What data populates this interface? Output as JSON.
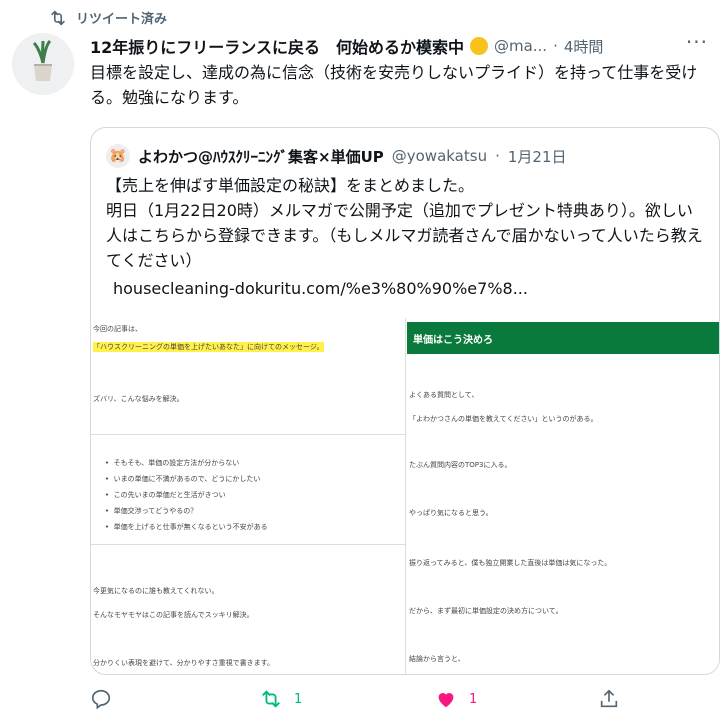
{
  "retweet": {
    "label": "リツイート済み"
  },
  "tweet": {
    "name": "12年振りにフリーランスに戻る　何始めるか模索中",
    "handle": "@ma...",
    "dot": "·",
    "time": "4時間",
    "text": "目標を設定し、達成の為に信念（技術を安売りしないプライド）を持って仕事を受ける。勉強になります。"
  },
  "quote": {
    "name": "よわかつ@ﾊｳｽｸﾘｰﾆﾝｸﾞ集客×単価UP",
    "handle": "@yowakatsu",
    "dot": "·",
    "date": "1月21日",
    "text_line1": "【売上を伸ばす単価設定の秘訣】をまとめました。",
    "text_rest": "明日（1月22日20時）メルマガで公開予定（追加でプレゼント特典あり）。欲しい人はこちらから登録できます。（もしメルマガ読者さんで届かないって人いたら教えてください）",
    "url": "housecleaning-dokuritu.com/%e3%80%90%e7%8..."
  },
  "media_left": {
    "l1": "今回の記事は、",
    "l2": "「ハウスクリーニングの単価を上げたいあなた」に向けてのメッセージ。",
    "l3": "ズバリ、こんな悩みを解決。",
    "bullets": [
      "そもそも、単価の設定方法が分からない",
      "いまの単価に不満があるので、どうにかしたい",
      "この先いまの単価だと生活がきつい",
      "単価交渉ってどうやるの？",
      "単価を上げると仕事が無くなるという不安がある"
    ],
    "l4": "今更気になるのに誰も教えてくれない。",
    "l5": "そんなモヤモヤはこの記事を読んでスッキリ解決。",
    "l6": "分かりくい表現を避けて、分かりやすさ重視で書きます。"
  },
  "media_right": {
    "heading": "単価はこう決めろ",
    "r1": "よくある質問として、",
    "r2": "「よわかつさんの単価を教えてください」というのがある。",
    "r3": "たぶん質問内容のTOP3に入る。",
    "r4": "やっぱり気になると思う。",
    "r5": "振り返ってみると、僕も独立開業した直後は単価は気になった。",
    "r6": "だから、まず最初に単価設定の決め方について。",
    "r7": "結論から言うと、"
  },
  "actions": {
    "reply_count": "",
    "retweet_count": "1",
    "like_count": "1"
  },
  "colors": {
    "retweet_active": "#00ba7c",
    "like_active": "#f91880",
    "muted": "#536471",
    "green_bar": "#0a7a3c"
  }
}
